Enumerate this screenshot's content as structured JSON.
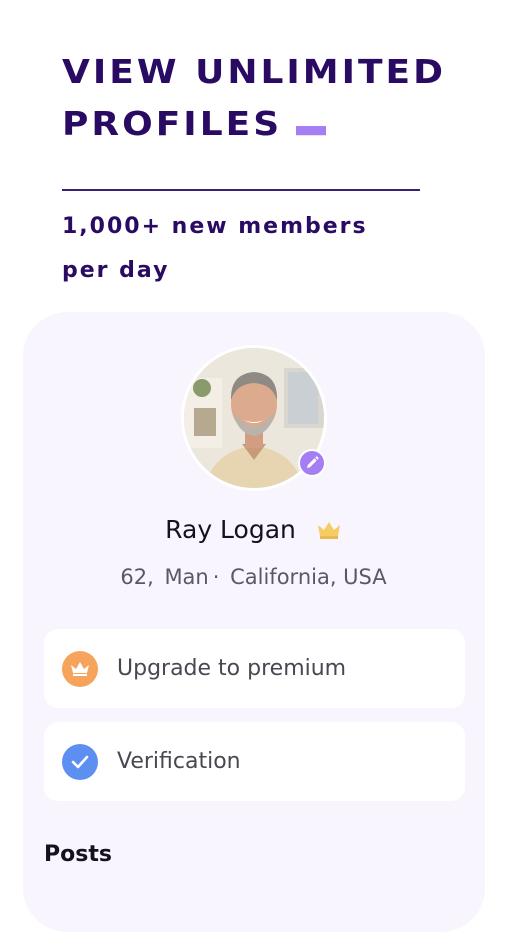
{
  "headline": {
    "line1": "VIEW UNLIMITED",
    "line2": "PROFILES"
  },
  "subtitle": {
    "line1": "1,000+ new members",
    "line2": "per day"
  },
  "profile": {
    "name": "Ray Logan",
    "age": "62,",
    "gender": "Man",
    "separator": "·",
    "location": "California, USA",
    "badge_icon": "crown-icon",
    "edit_icon": "pencil-icon"
  },
  "options": [
    {
      "label": "Upgrade to premium",
      "icon": "crown-icon",
      "color": "#f6a35b"
    },
    {
      "label": "Verification",
      "icon": "check-icon",
      "color": "#5d8ef1"
    }
  ],
  "section_title": "Posts",
  "colors": {
    "brand": "#2a0b63",
    "accent": "#a57ef3",
    "card_bg": "#f8f5fe"
  }
}
